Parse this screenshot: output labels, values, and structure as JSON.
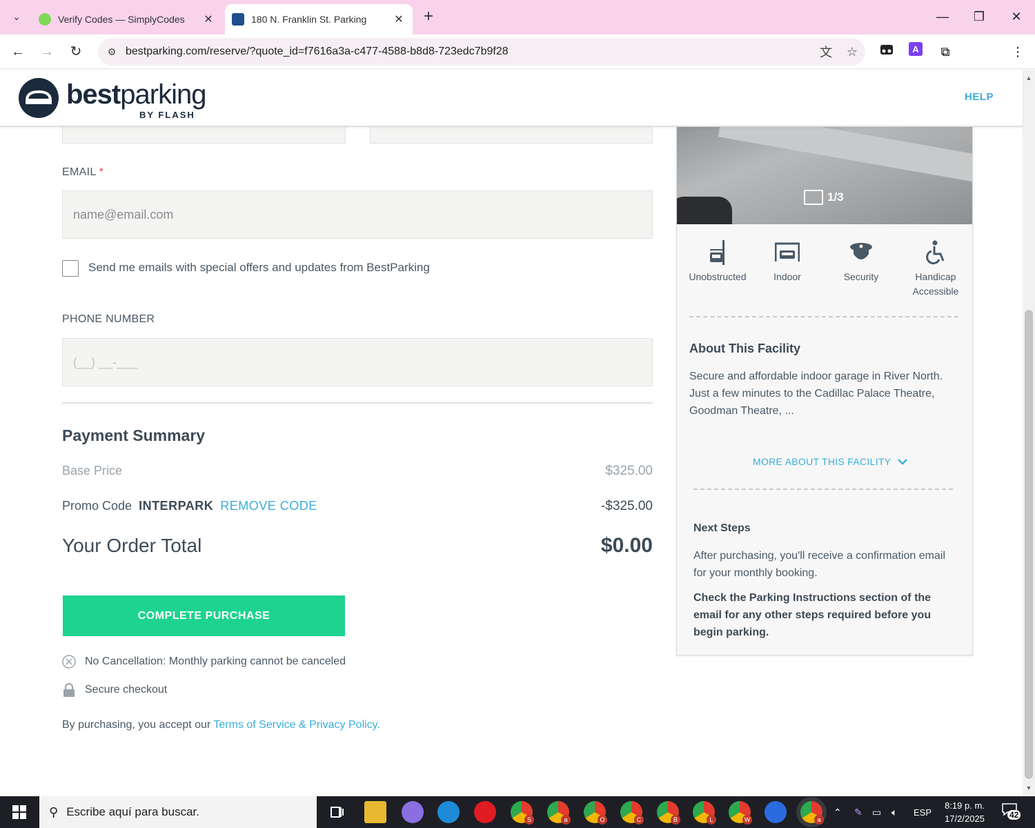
{
  "browser": {
    "tabs": [
      {
        "title": "Verify Codes — SimplyCodes",
        "favicon_color": "#7ed957",
        "active": false
      },
      {
        "title": "180 N. Franklin St. Parking",
        "favicon_color": "#1f4f8f",
        "active": true
      }
    ],
    "new_tab_symbol": "+",
    "window_controls": {
      "minimize": "—",
      "maximize": "❐",
      "close": "✕"
    },
    "url": "bestparking.com/reserve/?quote_id=f7616a3a-c477-4588-b8d8-723edc7b9f28",
    "profile_initial": "a"
  },
  "site": {
    "logo_bold": "best",
    "logo_light": "parking",
    "logo_sub": "BY FLASH",
    "help_label": "HELP"
  },
  "form": {
    "email_label": "EMAIL",
    "email_required": "*",
    "email_placeholder": "name@email.com",
    "offers_checkbox_label": "Send me emails with special offers and updates from BestParking",
    "offers_checked": false,
    "phone_label": "PHONE NUMBER",
    "phone_placeholder": "(__) __-___"
  },
  "summary": {
    "title": "Payment Summary",
    "base_price_label": "Base Price",
    "base_price_value": "$325.00",
    "promo_label": "Promo Code",
    "promo_code": "INTERPARK",
    "remove_code_label": "REMOVE CODE",
    "promo_value": "-$325.00",
    "total_label": "Your Order Total",
    "total_value": "$0.00",
    "cta_label": "COMPLETE PURCHASE",
    "no_cancel_text": "No Cancellation: Monthly parking cannot be canceled",
    "secure_text": "Secure checkout",
    "terms_prefix": "By purchasing, you accept our ",
    "terms_link": "Terms of Service & Privacy Policy."
  },
  "facility": {
    "photo_count": "1/3",
    "amenities": [
      {
        "label": "Unobstructed",
        "icon": "unobstructed-icon"
      },
      {
        "label": "Indoor",
        "icon": "indoor-icon"
      },
      {
        "label": "Security",
        "icon": "security-icon"
      },
      {
        "label": "Handicap Accessible",
        "icon": "wheelchair-icon"
      }
    ],
    "about_title": "About This Facility",
    "about_text": "Secure and affordable indoor garage in River North. Just a few minutes to the Cadillac Palace Theatre, Goodman Theatre, ...",
    "more_label": "MORE ABOUT THIS FACILITY",
    "next_steps_title": "Next Steps",
    "next_steps_text": "After purchasing, you'll receive a confirmation email for your monthly booking.",
    "next_steps_bold": "Check the Parking Instructions section of the email for any other steps required before you begin parking."
  },
  "taskbar": {
    "search_placeholder": "Escribe aquí para buscar.",
    "language": "ESP",
    "time": "8:19 p. m.",
    "date": "17/2/2025",
    "notifications": "42",
    "chrome_profiles": [
      "S",
      "a",
      "O",
      "C",
      "B",
      "L",
      "W",
      "a"
    ]
  }
}
